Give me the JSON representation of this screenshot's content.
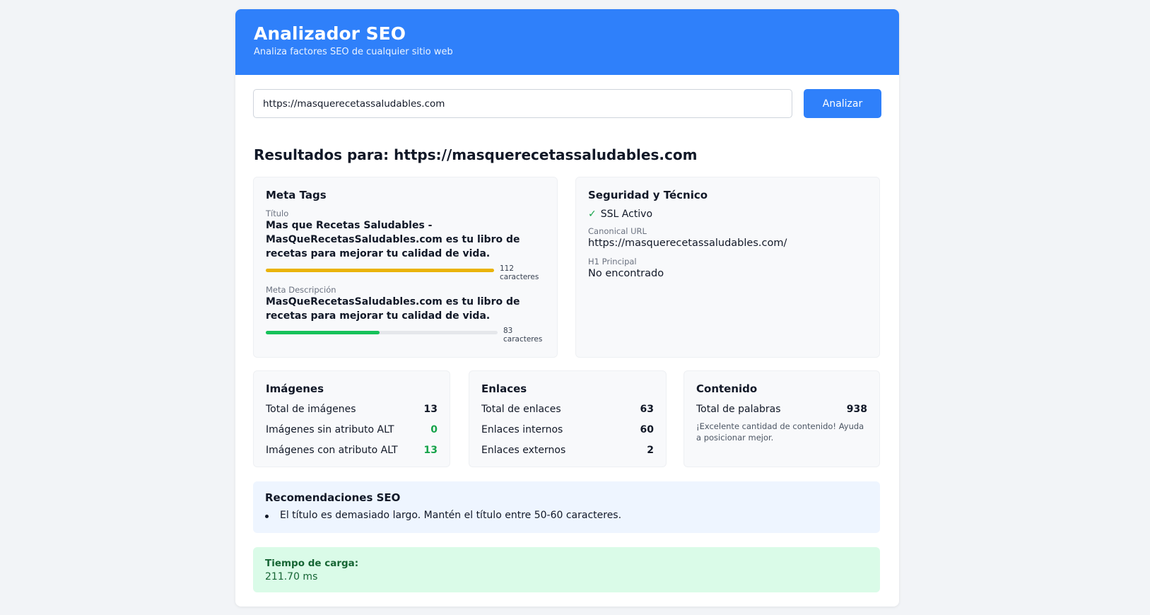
{
  "header": {
    "title": "Analizador SEO",
    "subtitle": "Analiza factores SEO de cualquier sitio web"
  },
  "search": {
    "value": "https://masquerecetassaludables.com",
    "button_label": "Analizar"
  },
  "results_title": "Resultados para: https://masquerecetassaludables.com",
  "meta_tags": {
    "heading": "Meta Tags",
    "title_label": "Título",
    "title_value": "Mas que Recetas Saludables - MasQueRecetasSaludables.com es tu libro de recetas para mejorar tu calidad de vida.",
    "title_count": "112",
    "title_count_unit": "caracteres",
    "title_bar_fraction": 1.0,
    "title_bar_color": "#eab308",
    "desc_label": "Meta Descripción",
    "desc_value": "MasQueRecetasSaludables.com es tu libro de recetas para mejorar tu calidad de vida.",
    "desc_count": "83",
    "desc_count_unit": "caracteres",
    "desc_bar_fraction": 0.49,
    "desc_bar_color": "#16c25a"
  },
  "security": {
    "heading": "Seguridad y Técnico",
    "ssl_icon": "check-icon",
    "ssl_label": "SSL Activo",
    "canonical_label": "Canonical URL",
    "canonical_value": "https://masquerecetassaludables.com/",
    "h1_label": "H1 Principal",
    "h1_value": "No encontrado"
  },
  "images": {
    "heading": "Imágenes",
    "rows": [
      {
        "label": "Total de imágenes",
        "value": "13"
      },
      {
        "label": "Imágenes sin atributo ALT",
        "value": "0"
      },
      {
        "label": "Imágenes con atributo ALT",
        "value": "13"
      }
    ]
  },
  "links": {
    "heading": "Enlaces",
    "rows": [
      {
        "label": "Total de enlaces",
        "value": "63"
      },
      {
        "label": "Enlaces internos",
        "value": "60"
      },
      {
        "label": "Enlaces externos",
        "value": "2"
      }
    ]
  },
  "content": {
    "heading": "Contenido",
    "words_label": "Total de palabras",
    "words_value": "938",
    "note": "¡Excelente cantidad de contenido! Ayuda a posicionar mejor."
  },
  "recommendations": {
    "heading": "Recomendaciones SEO",
    "items": [
      "El título es demasiado largo. Mantén el título entre 50-60 caracteres."
    ]
  },
  "load_time": {
    "label": "Tiempo de carga:",
    "value": "211.70 ms"
  },
  "colors": {
    "accent": "#2f80fa",
    "success": "#16a34a",
    "warning": "#eab308"
  }
}
